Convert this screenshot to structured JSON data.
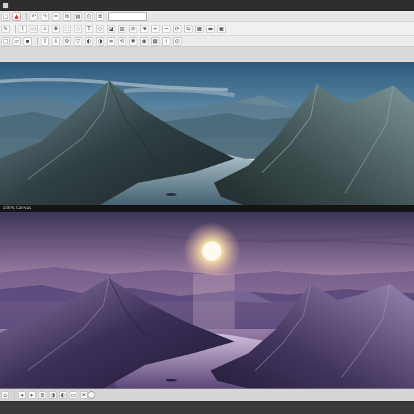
{
  "window": {
    "title_bar_icon": "app-icon"
  },
  "toolbar": {
    "row1_icons": [
      "file-icon",
      "warning-icon",
      "undo-icon",
      "redo-icon",
      "cut-icon",
      "copy-icon",
      "paste-icon",
      "print-icon",
      "layers-icon",
      "zoom-icon"
    ],
    "row2_icons": [
      "pen-icon",
      "brush-icon",
      "eraser-icon",
      "crop-icon",
      "move-icon",
      "select-icon",
      "lasso-icon",
      "text-icon",
      "shape-icon",
      "fill-icon",
      "gradient-icon",
      "eyedropper-icon",
      "hand-icon",
      "zoom-in-icon",
      "zoom-out-icon",
      "rotate-icon",
      "flip-icon",
      "grid-icon",
      "ruler-icon",
      "frame-icon"
    ],
    "row3_icons": [
      "new-icon",
      "open-icon",
      "save-icon",
      "export-icon",
      "import-icon",
      "settings-icon",
      "filter-icon",
      "adjust-icon",
      "mask-icon",
      "channel-icon",
      "history-icon",
      "brush-settings-icon",
      "color-icon",
      "swatch-icon",
      "info-icon",
      "navigator-icon"
    ]
  },
  "canvas_top": {
    "status_label": "100% Canvas"
  },
  "bottombar": {
    "icons": [
      "home-icon",
      "back-icon",
      "forward-icon",
      "layers-icon",
      "mask-icon",
      "adjust-icon",
      "folder-icon",
      "delete-icon"
    ]
  },
  "colors": {
    "sky_day_top": "#3b6b8e",
    "sky_day_bottom": "#d7dde0",
    "water_day": "#89a4b3",
    "mountain_day": "#2e3b40",
    "sky_dusk_top": "#3e3458",
    "sky_dusk_mid": "#c99bb0",
    "sun": "#fff3c8",
    "water_dusk": "#b49bc7",
    "mountain_dusk": "#2e2545"
  }
}
